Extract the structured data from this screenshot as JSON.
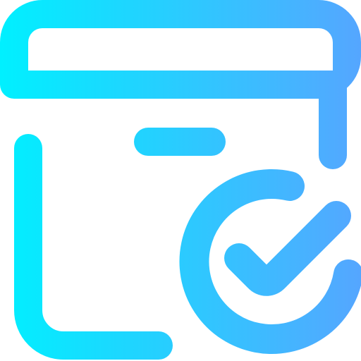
{
  "icon": {
    "name": "archive-box-check-icon",
    "gradient": {
      "start_color": "#00F0FF",
      "end_color": "#55A6FF"
    }
  }
}
